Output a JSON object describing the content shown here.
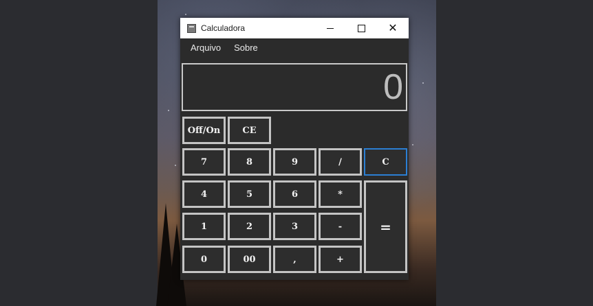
{
  "window": {
    "title": "Calculadora",
    "controls": {
      "minimize": "minimize-icon",
      "maximize": "maximize-icon",
      "close": "close-icon",
      "close_glyph": "✕"
    }
  },
  "menu": {
    "items": [
      "Arquivo",
      "Sobre"
    ]
  },
  "display": {
    "value": "0"
  },
  "buttons": {
    "off_on": "Off/On",
    "ce": "CE",
    "seven": "7",
    "eight": "8",
    "nine": "9",
    "divide": "/",
    "clear": "C",
    "four": "4",
    "five": "5",
    "six": "6",
    "multiply": "*",
    "one": "1",
    "two": "2",
    "three": "3",
    "minus": "-",
    "zero": "0",
    "double_zero": "00",
    "comma": ",",
    "plus": "+",
    "equals": "="
  },
  "colors": {
    "accent_focus": "#2b7fd4",
    "window_bg": "#2b2b2b",
    "button_border": "#c4c4c4"
  }
}
